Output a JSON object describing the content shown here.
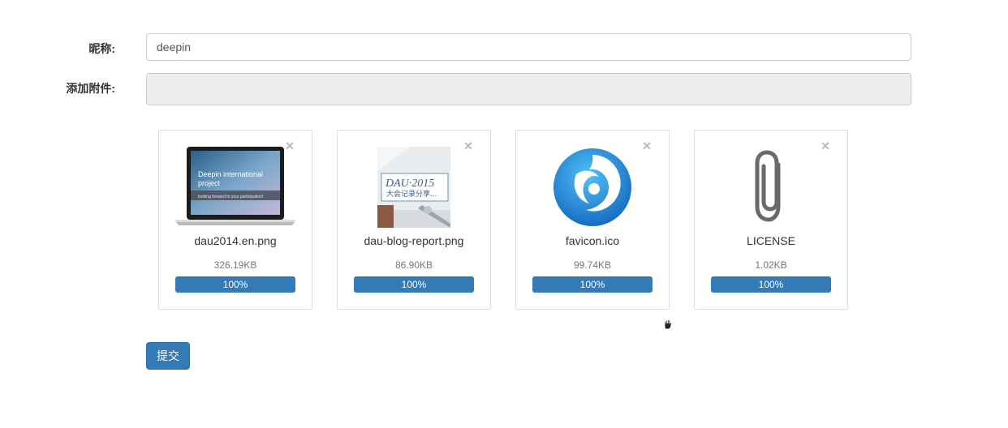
{
  "form": {
    "nickname_label": "昵称:",
    "nickname_value": "deepin",
    "attachment_label": "添加附件:",
    "attachment_value": ""
  },
  "files": [
    {
      "name": "dau2014.en.png",
      "size": "326.19KB",
      "progress_label": "100%",
      "progress": 1.0,
      "thumbnail": "laptop-screenshot-image",
      "thumbnail_text": [
        "Deepin international",
        "project",
        "looking forward to your participation!"
      ]
    },
    {
      "name": "dau-blog-report.png",
      "size": "86.90KB",
      "progress_label": "100%",
      "progress": 1.0,
      "thumbnail": "report-image",
      "thumbnail_text": [
        "DAU·2015",
        "大会记录分享..."
      ]
    },
    {
      "name": "favicon.ico",
      "size": "99.74KB",
      "progress_label": "100%",
      "progress": 1.0,
      "thumbnail": "deepin-logo-icon"
    },
    {
      "name": "LICENSE",
      "size": "1.02KB",
      "progress_label": "100%",
      "progress": 1.0,
      "thumbnail": "paperclip-icon"
    }
  ],
  "remove_icon": "×",
  "submit_label": "提交",
  "colors": {
    "primary": "#337ab7",
    "border": "#dddddd",
    "disabled_bg": "#eeeeee"
  }
}
